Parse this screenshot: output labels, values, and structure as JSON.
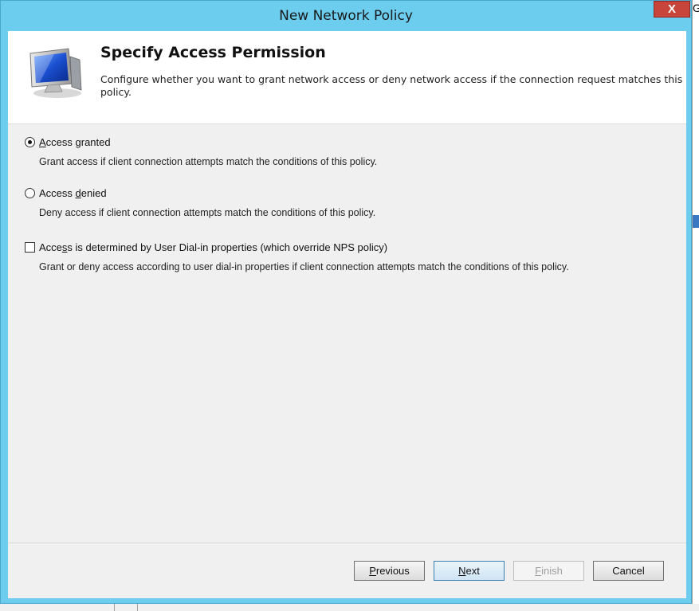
{
  "window": {
    "title": "New Network Policy",
    "close_label": "X"
  },
  "header": {
    "title": "Specify Access Permission",
    "description": "Configure whether you want to grant network access or deny network access if the connection request matches this policy."
  },
  "options": {
    "access_granted": {
      "label_pre": "",
      "label_ul": "A",
      "label_post": "ccess granted",
      "description": "Grant access if client connection attempts match the conditions of this policy.",
      "selected": true
    },
    "access_denied": {
      "label_pre": "Access ",
      "label_ul": "d",
      "label_post": "enied",
      "description": "Deny access if client connection attempts match the conditions of this policy.",
      "selected": false
    },
    "dial_in": {
      "label_pre": "Acce",
      "label_ul": "s",
      "label_post": "s is determined by User Dial-in properties (which override NPS policy)",
      "description": "Grant or deny access according to user dial-in properties if client connection attempts match the conditions of this policy.",
      "checked": false
    }
  },
  "buttons": {
    "previous": {
      "pre": "",
      "ul": "P",
      "post": "revious"
    },
    "next": {
      "pre": "",
      "ul": "N",
      "post": "ext"
    },
    "finish": {
      "pre": "",
      "ul": "F",
      "post": "inish"
    },
    "cancel": "Cancel"
  },
  "background": {
    "right_char": "G"
  },
  "icons": {
    "header": "monitor-network-icon"
  }
}
